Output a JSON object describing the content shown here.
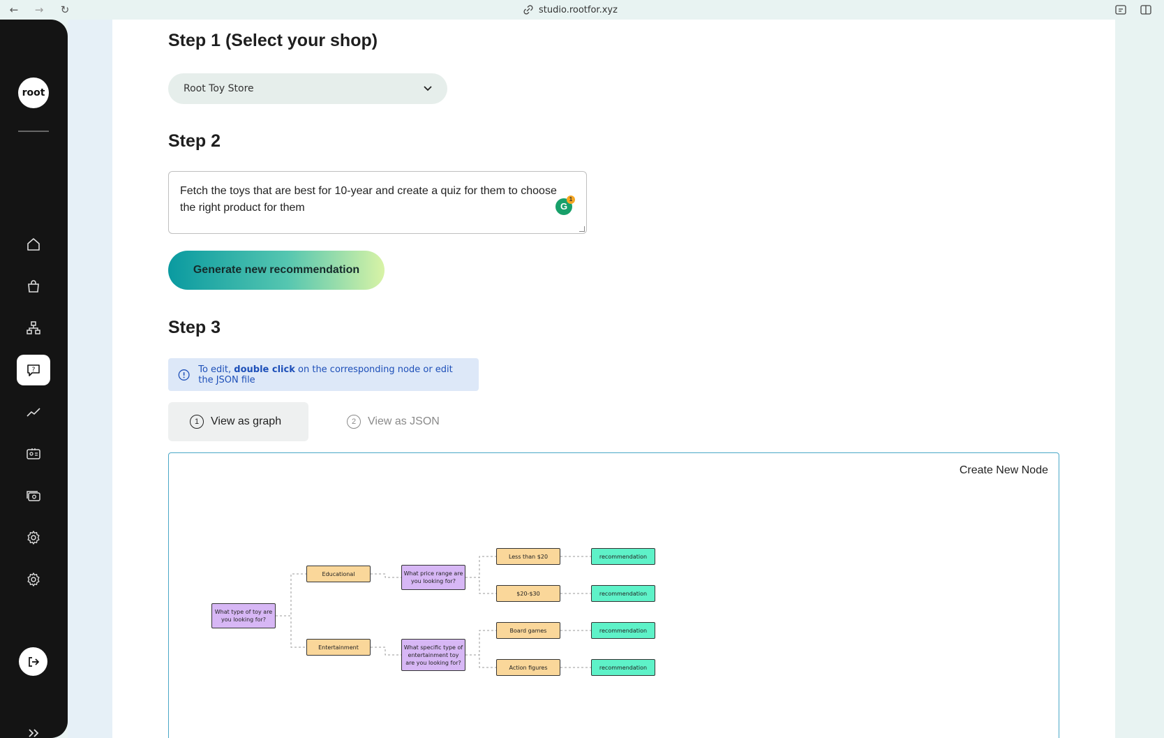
{
  "browser": {
    "url": "studio.rootfor.xyz"
  },
  "sidebar": {
    "logo": "root",
    "icons": [
      "home-icon",
      "shopping-bag-icon",
      "hierarchy-icon",
      "quiz-icon",
      "trend-icon",
      "id-card-icon",
      "money-icon",
      "settings-icon",
      "settings-icon"
    ],
    "active": "quiz-icon"
  },
  "step1": {
    "title": "Step 1 (Select your shop)",
    "shop_value": "Root Toy Store"
  },
  "step2": {
    "title": "Step 2",
    "prompt": "Fetch the toys that are best for 10-year and create a quiz for them to choose the right product for them",
    "grammarly_count": "1",
    "generate_label": "Generate new recommendation"
  },
  "step3": {
    "title": "Step 3",
    "info_prefix": "To edit,",
    "info_bold": "double click",
    "info_suffix": "on the corresponding node or edit the JSON file",
    "tabs": [
      {
        "num": "1",
        "label": "View as graph"
      },
      {
        "num": "2",
        "label": "View as JSON"
      }
    ],
    "create_node_label": "Create New Node"
  },
  "graph": {
    "root": "What type of toy are you looking for?",
    "answers": [
      "Educational",
      "Entertainment"
    ],
    "questions": [
      "What price range are you looking for?",
      "What specific type of entertainment toy are you looking for?"
    ],
    "options": [
      "Less than $20",
      "$20-$30",
      "Board games",
      "Action figures"
    ],
    "recommendations": [
      "recommendation",
      "recommendation",
      "recommendation",
      "recommendation"
    ]
  },
  "colors": {
    "question_node": "#d7b7f5",
    "answer_node": "#fad79a",
    "recommendation_node": "#5ef2c8",
    "accent": "#0a9aa0"
  }
}
